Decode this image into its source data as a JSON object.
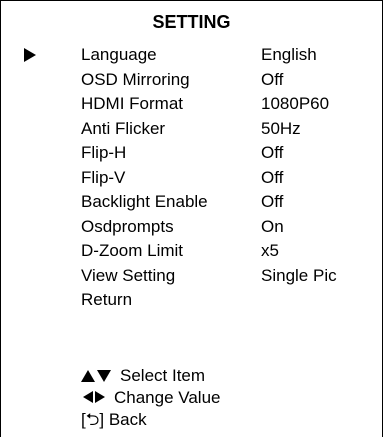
{
  "menu": {
    "title": "SETTING",
    "items": [
      {
        "label": "Language",
        "value": "English"
      },
      {
        "label": "OSD Mirroring",
        "value": "Off"
      },
      {
        "label": "HDMI Format",
        "value": "1080P60"
      },
      {
        "label": "Anti Flicker",
        "value": "50Hz"
      },
      {
        "label": "Flip-H",
        "value": "Off"
      },
      {
        "label": "Flip-V",
        "value": "Off"
      },
      {
        "label": "Backlight Enable",
        "value": "Off"
      },
      {
        "label": "Osdprompts",
        "value": "On"
      },
      {
        "label": "D-Zoom Limit",
        "value": "x5"
      },
      {
        "label": "View Setting",
        "value": "Single Pic"
      },
      {
        "label": "Return",
        "value": ""
      }
    ]
  },
  "hints": {
    "select_item": "Select Item",
    "change_value": "Change Value",
    "back": "Back",
    "back_icon_text": "[⮌]"
  },
  "icons": {
    "pointer": "selection-arrow-icon",
    "updown": "up-down-arrows-icon",
    "leftright": "left-right-arrows-icon",
    "back": "return-arrow-icon"
  }
}
